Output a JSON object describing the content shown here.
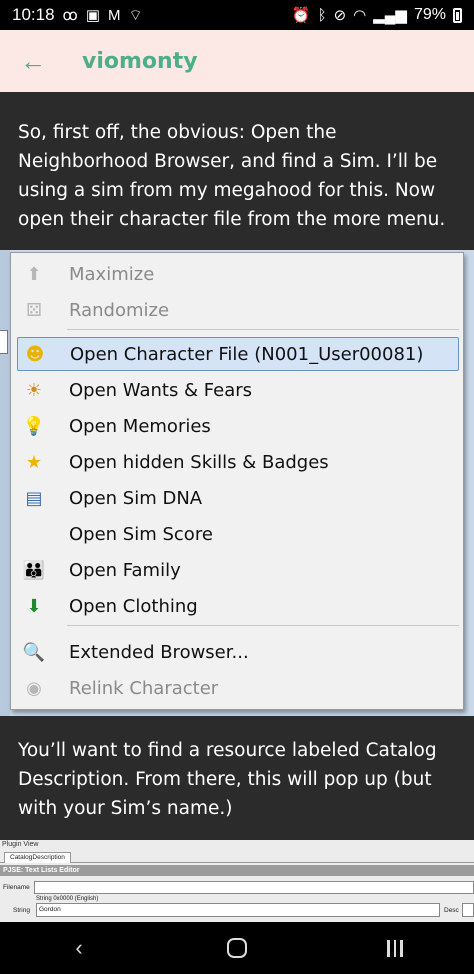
{
  "status_bar": {
    "time": "10:18",
    "left_icons": [
      "voicemail-icon",
      "gallery-icon",
      "gmail-icon",
      "broadcast-icon"
    ],
    "right_icons": [
      "alarm-icon",
      "bluetooth-icon",
      "mute-icon",
      "wifi-icon",
      "signal-icon"
    ],
    "battery_percent": "79%"
  },
  "header": {
    "blog_name": "viomonty"
  },
  "post": {
    "paragraph1": "So, first off, the obvious: Open the Neighborhood Browser, and find a Sim. I’ll be using a sim from my megahood for this. Now open their character file from the more menu.",
    "paragraph2": "You’ll want to find a resource labeled Catalog Description. From there, this will pop up (but with your Sim’s name.)"
  },
  "context_menu": {
    "items": [
      {
        "label": "Maximize",
        "icon": "maximize-icon",
        "glyph": "⬆",
        "color": "#b7b7b7",
        "disabled": true,
        "selected": false
      },
      {
        "label": "Randomize",
        "icon": "randomize-icon",
        "glyph": "⚄",
        "color": "#b7b7b7",
        "disabled": true,
        "selected": false
      },
      {
        "label": "Open Character File (N001_User00081)",
        "icon": "character-file-icon",
        "glyph": "☻",
        "color": "#e8b400",
        "disabled": false,
        "selected": true
      },
      {
        "label": "Open Wants & Fears",
        "icon": "wants-fears-icon",
        "glyph": "☀",
        "color": "#d58a1e",
        "disabled": false,
        "selected": false
      },
      {
        "label": "Open Memories",
        "icon": "lightbulb-icon",
        "glyph": "💡",
        "color": "#e8c400",
        "disabled": false,
        "selected": false
      },
      {
        "label": "Open hidden Skills & Badges",
        "icon": "star-icon",
        "glyph": "★",
        "color": "#f0b400",
        "disabled": false,
        "selected": false
      },
      {
        "label": "Open Sim DNA",
        "icon": "dna-icon",
        "glyph": "▤",
        "color": "#3b6fb5",
        "disabled": false,
        "selected": false
      },
      {
        "label": "Open Sim Score",
        "icon": "",
        "glyph": "",
        "color": "#000",
        "disabled": false,
        "selected": false
      },
      {
        "label": "Open Family",
        "icon": "family-icon",
        "glyph": "👪",
        "color": "#3a7d3a",
        "disabled": false,
        "selected": false
      },
      {
        "label": "Open Clothing",
        "icon": "clothing-icon",
        "glyph": "⬇",
        "color": "#1e8a2e",
        "disabled": false,
        "selected": false
      },
      {
        "label": "Extended Browser...",
        "icon": "browser-icon",
        "glyph": "🔍",
        "color": "#4a6fa5",
        "disabled": false,
        "selected": false
      },
      {
        "label": "Relink Character",
        "icon": "relink-icon",
        "glyph": "◉",
        "color": "#b7b7b7",
        "disabled": true,
        "selected": false
      }
    ]
  },
  "plugin_view": {
    "title": "Plugin View",
    "tab": "CatalogDescription",
    "header": "PJSE: Text Lists Editor",
    "filename_label": "Filename",
    "string_caption": "String 0x0000 (English)",
    "string_label": "String",
    "string_value": "Gordon",
    "desc_label": "Desc"
  },
  "nav_bar": {
    "back_glyph": "‹",
    "icons": [
      "back-icon",
      "home-icon",
      "recents-icon"
    ]
  },
  "colors": {
    "accent": "#4caf87",
    "header_bg": "#fce8e4",
    "post_bg": "#2b2b2b",
    "menu_selected": "#d5e3f6"
  }
}
